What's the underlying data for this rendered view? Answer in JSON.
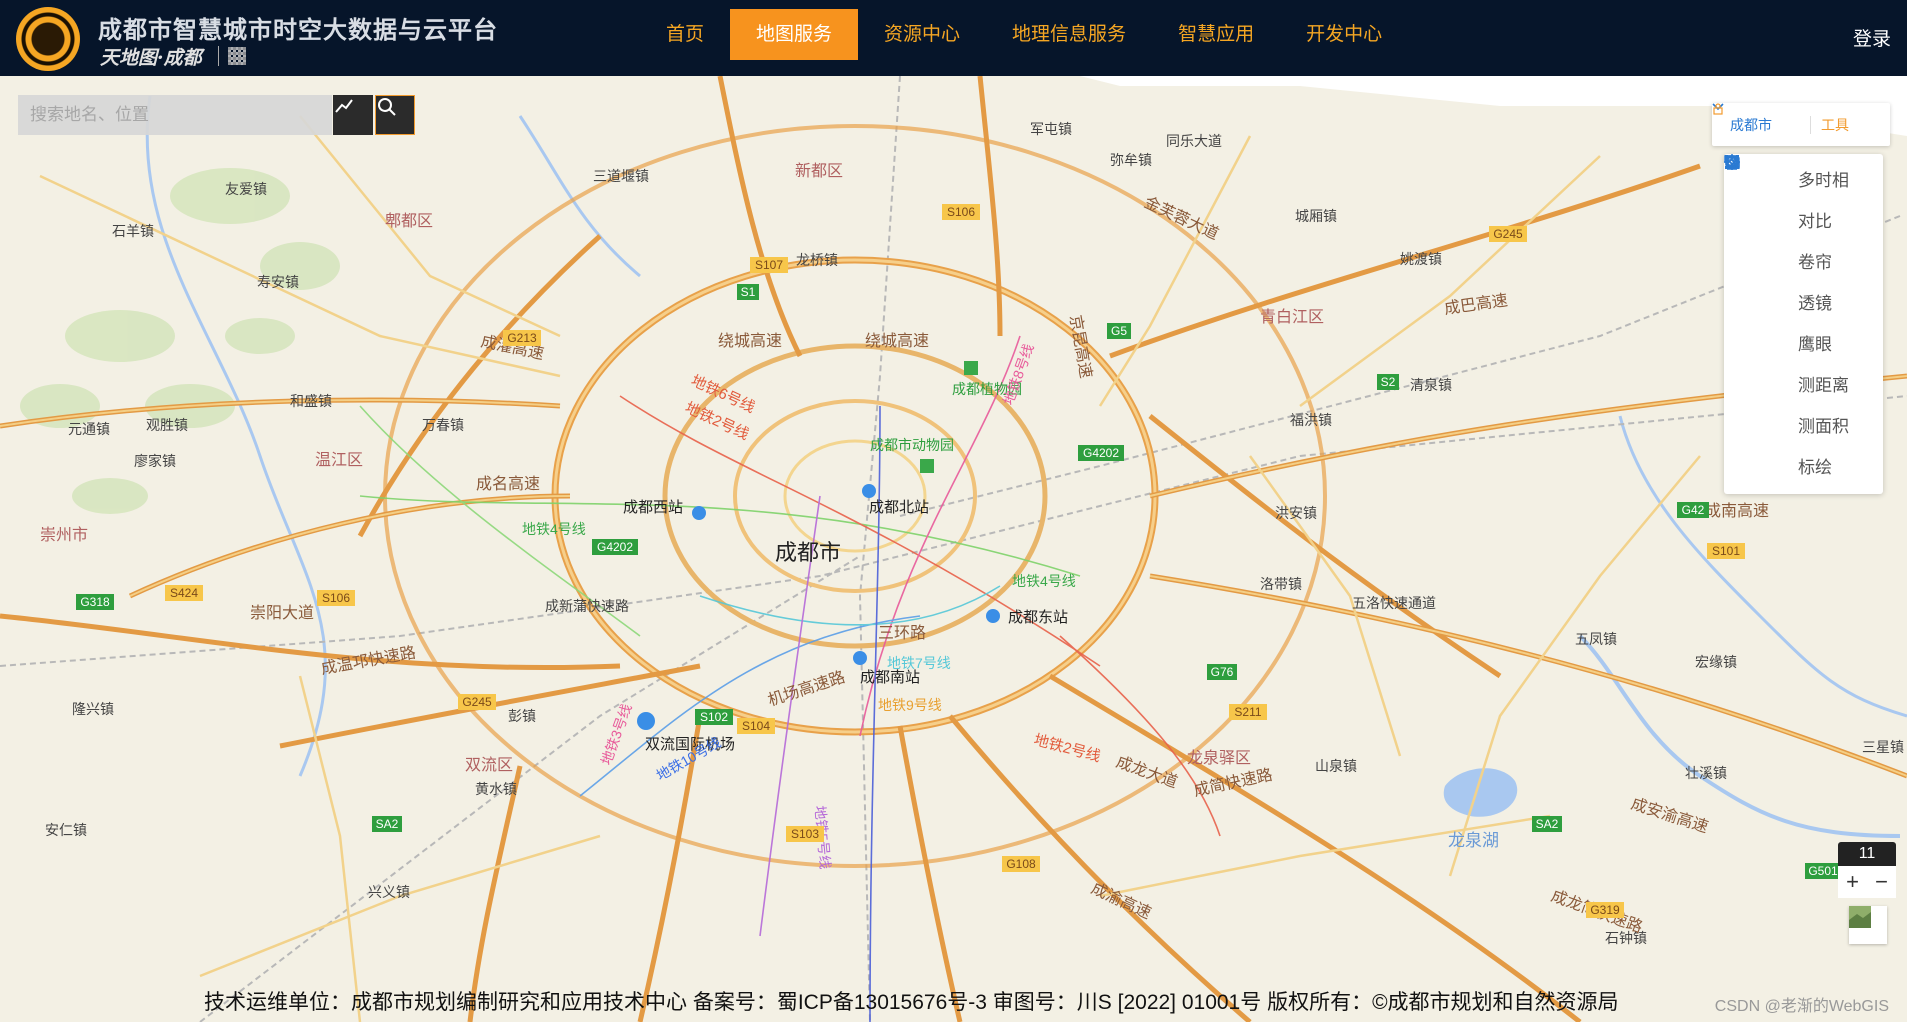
{
  "header": {
    "title": "成都市智慧城市时空大数据与云平台",
    "sub_brand": "天地图·成都",
    "nav": [
      "首页",
      "地图服务",
      "资源中心",
      "地理信息服务",
      "智慧应用",
      "开发中心"
    ],
    "active_nav": "地图服务",
    "login": "登录"
  },
  "search": {
    "placeholder": "搜索地名、位置"
  },
  "toolbar": {
    "city": "成都市",
    "tools_label": "工具",
    "items": [
      "多时相",
      "对比",
      "卷帘",
      "透镜",
      "鹰眼",
      "测距离",
      "测面积",
      "标绘"
    ]
  },
  "map": {
    "zoom_level": "11",
    "labels": {
      "city": "成都市",
      "areas": [
        "郫都区",
        "温江区",
        "崇州市",
        "双流区",
        "青白江区",
        "龙泉驿区",
        "新都区",
        "龙泉湖"
      ],
      "towns": [
        "友爱镇",
        "石羊镇",
        "寿安镇",
        "和盛镇",
        "元通镇",
        "观胜镇",
        "廖家镇",
        "万春镇",
        "三道堰镇",
        "龙桥镇",
        "军屯镇",
        "弥牟镇",
        "同乐大道",
        "城厢镇",
        "姚渡镇",
        "清泉镇",
        "福洪镇",
        "洪安镇",
        "洛带镇",
        "五凤镇",
        "宏缘镇",
        "壮溪镇",
        "三星镇",
        "山泉镇",
        "彭镇",
        "黄水镇",
        "安仁镇",
        "隆兴镇",
        "兴义镇",
        "石钟镇"
      ],
      "stations": [
        "成都西站",
        "成都北站",
        "成都东站",
        "成都南站",
        "双流国际机场",
        "成都植物园",
        "成都市动物园"
      ],
      "roads": [
        "绕城高速",
        "成灌高速",
        "成名高速",
        "成温邛快速路",
        "崇阳大道",
        "成新蒲快速路",
        "成巴高速",
        "成南高速",
        "成龙大道",
        "成简快速路",
        "五洛快速通道",
        "成安渝高速",
        "成渝高速",
        "成龙简快速路",
        "三环路",
        "机场高速路",
        "金芙蓉大道",
        "京昆高速"
      ],
      "metro": [
        "地铁6号线",
        "地铁2号线",
        "地铁4号线",
        "地铁9号线",
        "地铁10号线",
        "地铁3号线",
        "地铁5号线",
        "地铁7号线",
        "地铁8号线",
        "地铁1号线"
      ],
      "shields": [
        "S106",
        "S107",
        "G213",
        "S1",
        "G5",
        "G245",
        "G4202",
        "G4202",
        "S2",
        "G42",
        "S101",
        "G318",
        "S424",
        "S106",
        "G245",
        "S102",
        "S104",
        "S103",
        "SA2",
        "G76",
        "S211",
        "G108",
        "SA2",
        "G319",
        "G501"
      ]
    }
  },
  "footer": {
    "text": "技术运维单位：成都市规划编制研究和应用技术中心 备案号：蜀ICP备13015676号-3 审图号：川S [2022] 01001号 版权所有：©成都市规划和自然资源局",
    "watermark": "CSDN @老渐的WebGIS"
  },
  "colors": {
    "header_bg": "#06152a",
    "accent": "#f7931e",
    "link": "#2a7ad2"
  }
}
